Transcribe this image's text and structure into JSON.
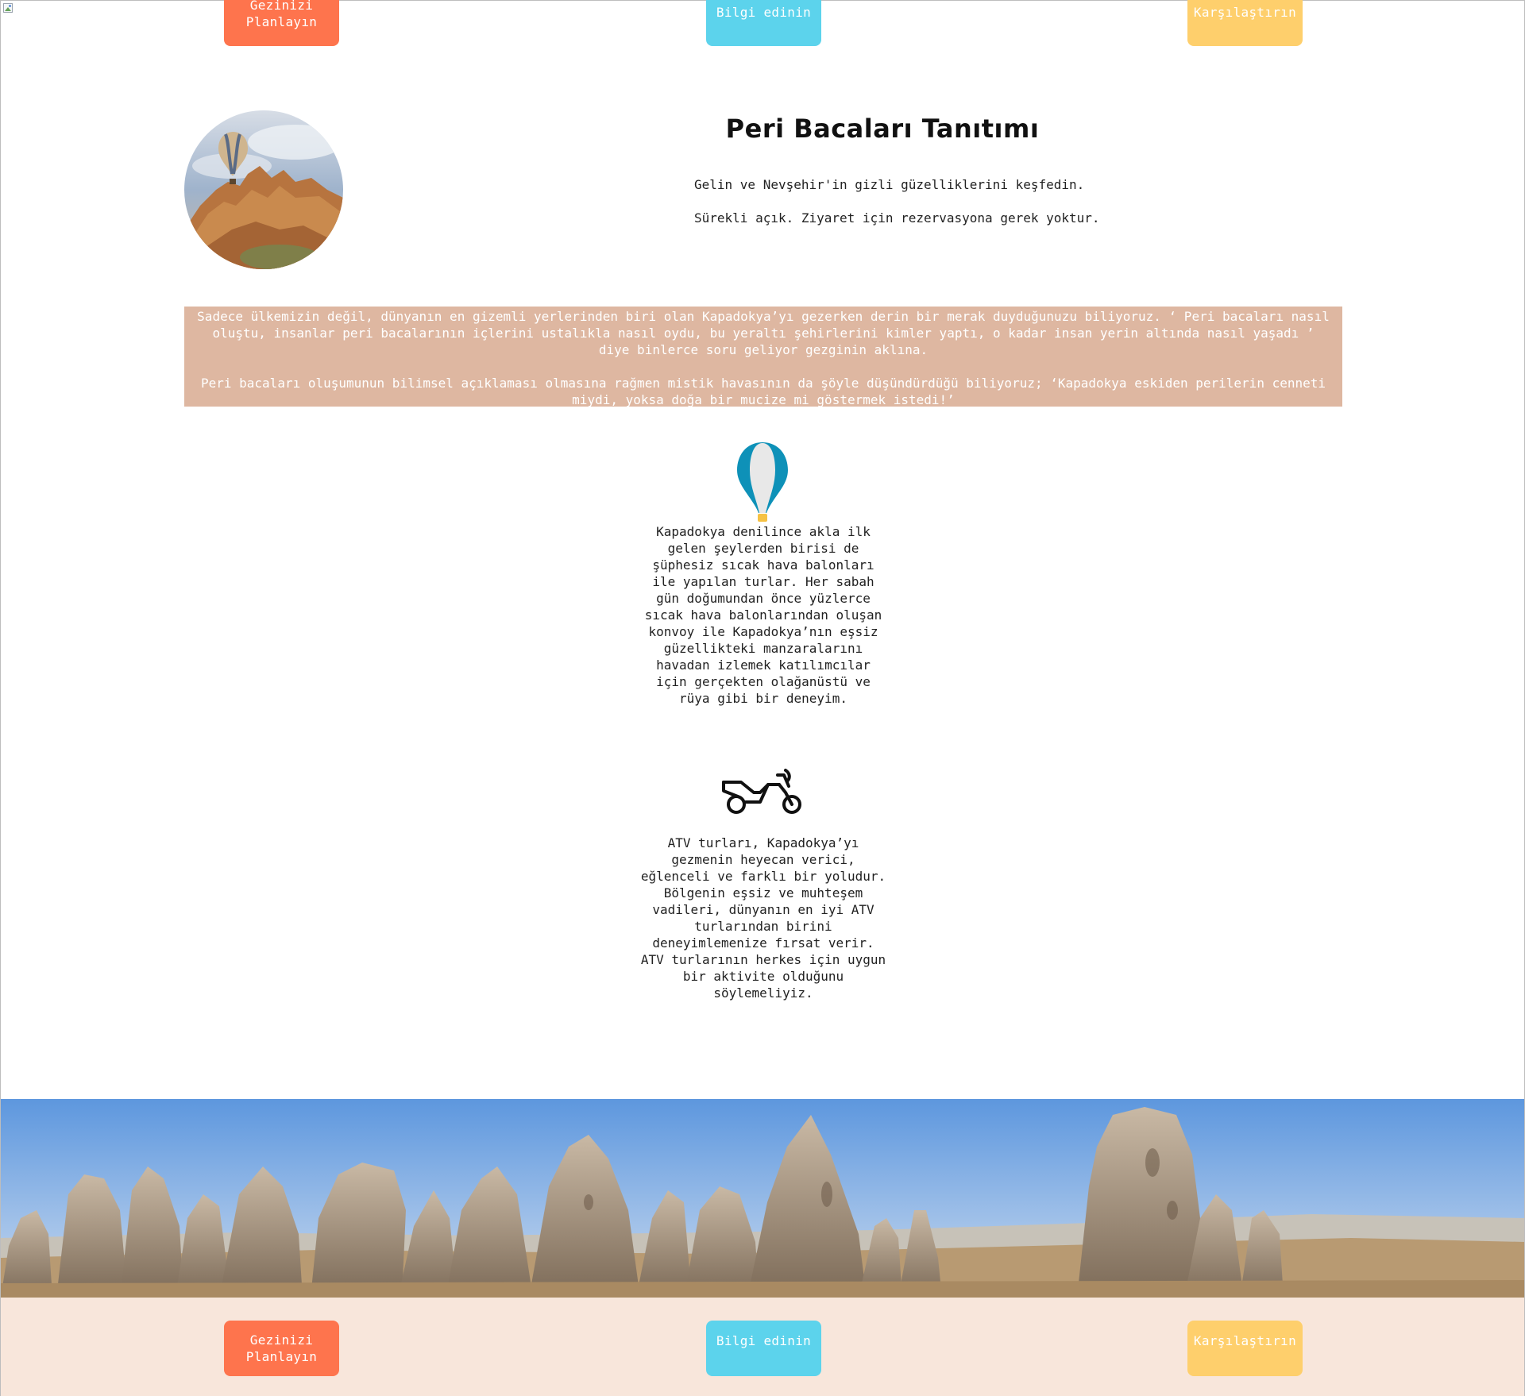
{
  "nav": {
    "plan_label": "Gezinizi Planlayın",
    "info_label": "Bilgi edinin",
    "compare_label": "Karşılaştırın"
  },
  "hero": {
    "title": "Peri Bacaları Tanıtımı",
    "line1": "Gelin ve Nevşehir'in gizli güzelliklerini keşfedin.",
    "line2": "Sürekli açık. Ziyaret için rezervasyona gerek yoktur."
  },
  "story": {
    "paragraph1": "Sadece ülkemizin değil, dünyanın en gizemli yerlerinden biri olan Kapadokya’yı gezerken derin bir merak duyduğunuzu biliyoruz. ‘ Peri bacaları nasıl oluştu, insanlar peri bacalarının içlerini ustalıkla nasıl oydu, bu yeraltı şehirlerini kimler yaptı, o kadar insan yerin altında nasıl yaşadı ’ diye binlerce soru geliyor gezginin aklına.",
    "paragraph2": "Peri bacaları oluşumunun bilimsel açıklaması olmasına rağmen mistik havasının da şöyle düşündürdüğü biliyoruz; ‘Kapadokya eskiden perilerin cenneti miydi, yoksa doğa bir mucize mi göstermek istedi!’"
  },
  "features": [
    {
      "icon": "hot-air-balloon-icon",
      "text": "Kapadokya denilince akla ilk gelen şeylerden birisi de şüphesiz sıcak hava balonları ile yapılan turlar. Her sabah gün doğumundan önce yüzlerce sıcak hava balonlarından oluşan konvoy ile Kapadokya’nın eşsiz güzellikteki manzaralarını havadan izlemek katılımcılar için gerçekten olağanüstü ve rüya gibi bir deneyim."
    },
    {
      "icon": "motorcycle-icon",
      "text": "ATV turları, Kapadokya’yı gezmenin heyecan verici, eğlenceli ve farklı bir yoludur. Bölgenin eşsiz ve muhteşem vadileri, dünyanın en iyi ATV turlarından birini deneyimlemenize fırsat verir. ATV turlarının herkes için uygun bir aktivite olduğunu söylemeliyiz."
    }
  ],
  "footer": {
    "plan_label": "Gezinizi Planlayın",
    "info_label": "Bilgi edinin",
    "compare_label": "Karşılaştırın"
  },
  "colors": {
    "orange": "#fe744d",
    "blue": "#5cd3ec",
    "yellow": "#fecf6c",
    "story_bg": "#deb7a1",
    "footer_bg": "#f8e6db"
  }
}
